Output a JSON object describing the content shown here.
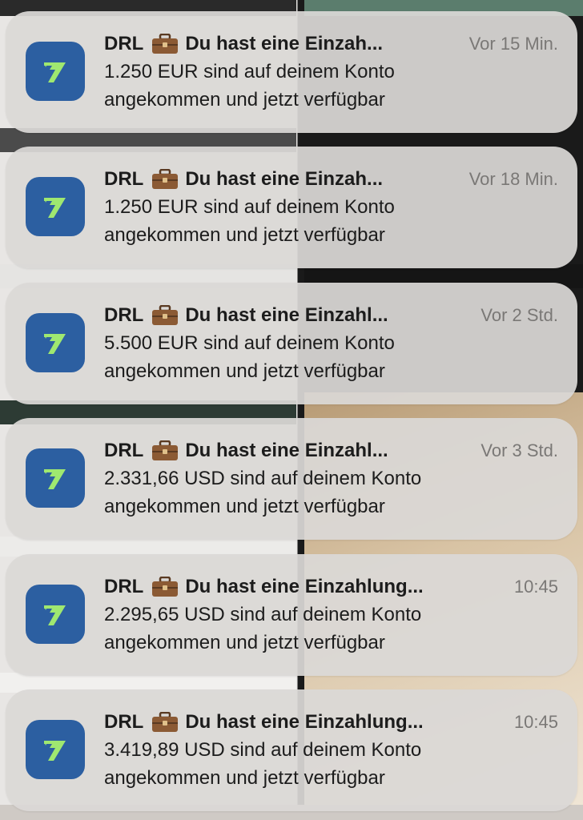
{
  "notifications": [
    {
      "app": "DRL",
      "title": "Du hast eine Einzah...",
      "time": "Vor 15 Min.",
      "line1": "1.250 EUR sind auf deinem Konto",
      "line2": "angekommen und jetzt verfügbar"
    },
    {
      "app": "DRL",
      "title": "Du hast eine Einzah...",
      "time": "Vor 18 Min.",
      "line1": "1.250 EUR sind auf deinem Konto",
      "line2": "angekommen und jetzt verfügbar"
    },
    {
      "app": "DRL",
      "title": "Du hast eine Einzahl...",
      "time": "Vor 2 Std.",
      "line1": "5.500 EUR sind auf deinem Konto",
      "line2": "angekommen und jetzt verfügbar"
    },
    {
      "app": "DRL",
      "title": "Du hast eine Einzahl...",
      "time": "Vor 3 Std.",
      "line1": "2.331,66 USD sind auf deinem Konto",
      "line2": "angekommen und jetzt verfügbar"
    },
    {
      "app": "DRL",
      "title": "Du hast eine Einzahlung...",
      "time": "10:45",
      "line1": "2.295,65 USD sind auf deinem Konto",
      "line2": "angekommen und jetzt verfügbar"
    },
    {
      "app": "DRL",
      "title": "Du hast eine Einzahlung...",
      "time": "10:45",
      "line1": "3.419,89 USD sind auf deinem Konto",
      "line2": "angekommen und jetzt verfügbar"
    }
  ],
  "icons": {
    "app_icon": "wise-logo-icon",
    "emoji": "briefcase-icon",
    "app_icon_color": "#2c5fa1",
    "app_icon_glyph_color": "#9fe870"
  }
}
